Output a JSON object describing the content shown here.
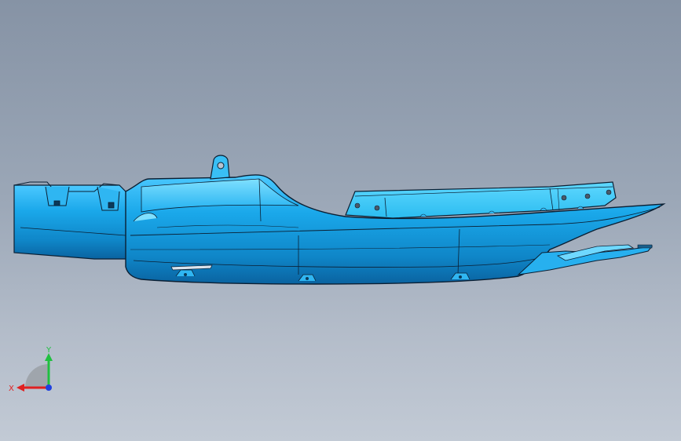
{
  "viewport": {
    "model_color": "#1aa0e0",
    "model_highlight": "#5fd3ff",
    "model_shadow": "#0a6fb0",
    "edge_color": "#0b1f33"
  },
  "triad": {
    "x_label": "X",
    "y_label": "Y",
    "x_color": "#e02020",
    "y_color": "#20c040",
    "z_color": "#2040e0"
  }
}
